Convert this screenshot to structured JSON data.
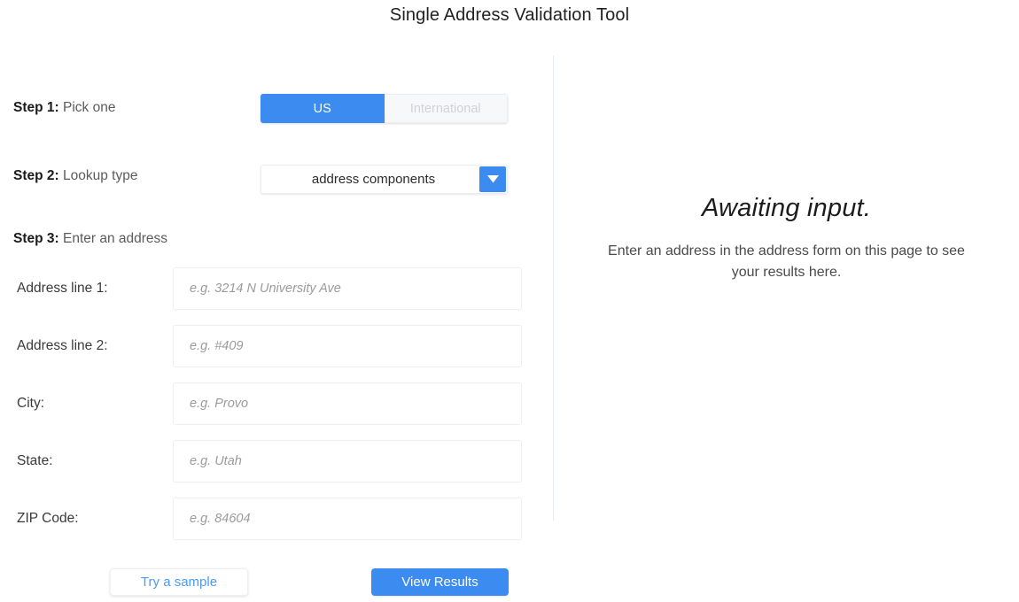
{
  "page": {
    "title": "Single Address Validation Tool"
  },
  "colors": {
    "accent": "#3b8bf0",
    "accent_text": "#4a9bf5",
    "inactive_text": "#cfd3d6",
    "divider": "#e3eaf0",
    "placeholder": "#9b9b9b"
  },
  "form": {
    "step1": {
      "number": "Step 1:",
      "description": "Pick one",
      "toggle": {
        "options": [
          "US",
          "International"
        ],
        "selected": "US",
        "us_label": "US",
        "international_label": "International"
      }
    },
    "step2": {
      "number": "Step 2:",
      "description": "Lookup type",
      "select": {
        "value": "address components",
        "options": [
          "address components"
        ],
        "arrow_icon": "chevron-down-icon"
      }
    },
    "step3": {
      "number": "Step 3:",
      "description": "Enter an address",
      "fields": [
        {
          "label": "Address line 1:",
          "value": "",
          "placeholder": "e.g. 3214 N University Ave",
          "name": "address-line-1"
        },
        {
          "label": "Address line 2:",
          "value": "",
          "placeholder": "e.g. #409",
          "name": "address-line-2"
        },
        {
          "label": "City:",
          "value": "",
          "placeholder": "e.g. Provo",
          "name": "city"
        },
        {
          "label": "State:",
          "value": "",
          "placeholder": "e.g. Utah",
          "name": "state"
        },
        {
          "label": "ZIP Code:",
          "value": "",
          "placeholder": "e.g. 84604",
          "name": "zip-code"
        }
      ]
    },
    "buttons": {
      "sample": "Try a sample",
      "results": "View Results"
    }
  },
  "results": {
    "heading": "Awaiting input.",
    "body": "Enter an address in the address form on this page to see your results here."
  }
}
